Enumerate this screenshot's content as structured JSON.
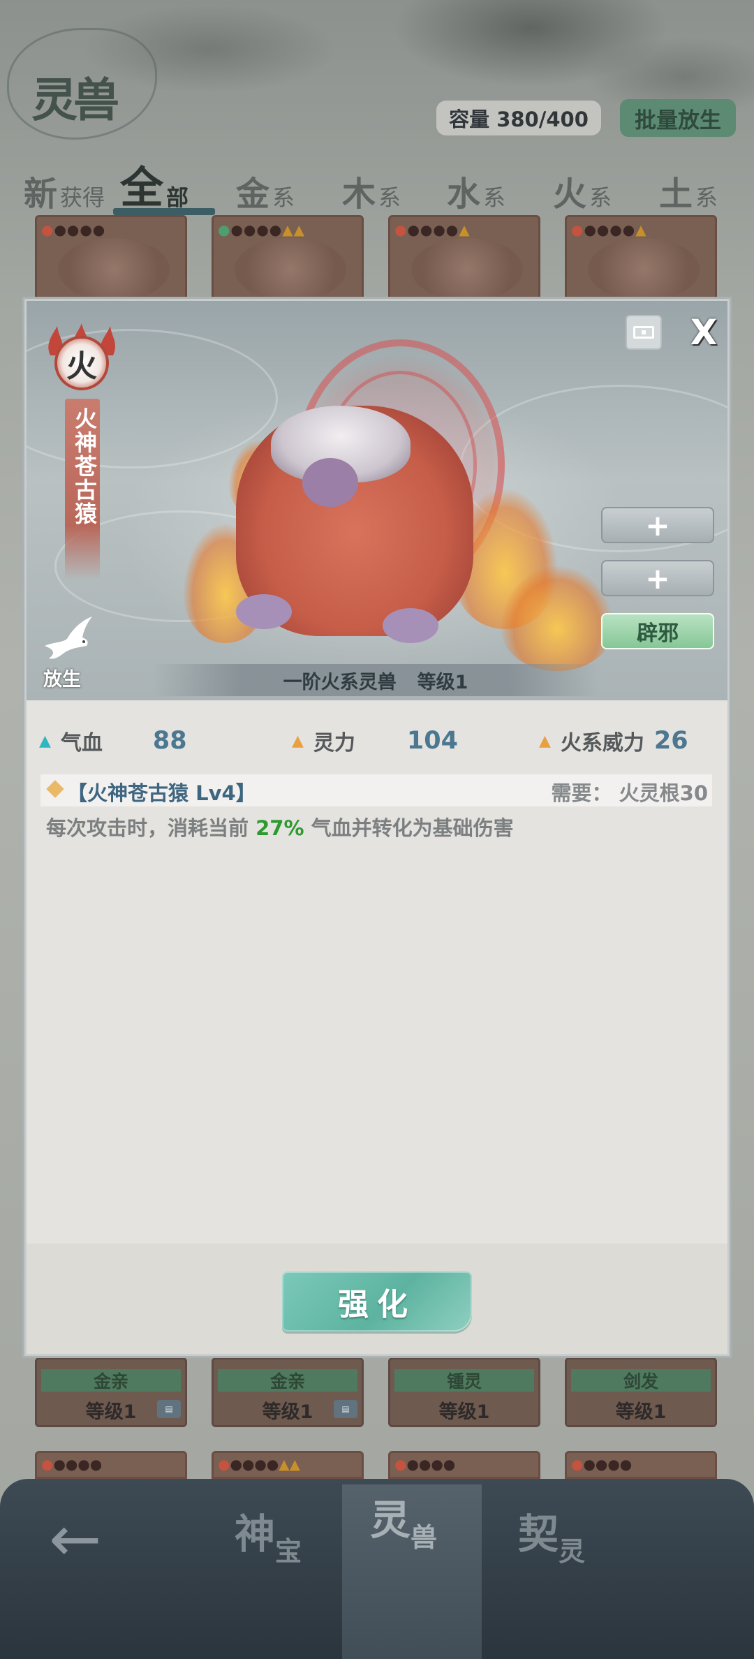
{
  "header": {
    "logo_text": "灵兽",
    "capacity": "容量 380/400",
    "batch_release": "批量放生"
  },
  "tabs": [
    {
      "big": "新",
      "small": "获得"
    },
    {
      "big": "全",
      "small": "部"
    },
    {
      "big": "金",
      "small": "系"
    },
    {
      "big": "木",
      "small": "系"
    },
    {
      "big": "水",
      "small": "系"
    },
    {
      "big": "火",
      "small": "系"
    },
    {
      "big": "土",
      "small": "系"
    }
  ],
  "bottom_cards": [
    {
      "tag": "金亲",
      "level": "等级1"
    },
    {
      "tag": "金亲",
      "level": "等级1"
    },
    {
      "tag": "锺灵",
      "level": "等级1"
    },
    {
      "tag": "剑发",
      "level": "等级1"
    }
  ],
  "bottom_nav": {
    "items": [
      {
        "big": "神",
        "small": "宝"
      },
      {
        "big": "灵",
        "small": "兽"
      },
      {
        "big": "契",
        "small": "灵"
      }
    ]
  },
  "modal": {
    "element": "火",
    "beast_name": "火神苍古猿",
    "release_label": "放生",
    "slot_add_1": "+",
    "slot_add_2": "+",
    "slot_active": "辟邪",
    "caption_rank": "一阶火系灵兽",
    "caption_level": "等级1",
    "stats": [
      {
        "label": "气血",
        "value": "88",
        "color": "#2fb6c0"
      },
      {
        "label": "灵力",
        "value": "104",
        "color": "#e8a040"
      },
      {
        "label": "火系威力",
        "value": "26",
        "color": "#e8a040"
      }
    ],
    "skill": {
      "name": "【火神苍古猿 Lv4】",
      "requirement": "需要：  火灵根30",
      "desc_before": "每次攻击时，消耗当前 ",
      "desc_pct": "27%",
      "desc_after": " 气血并转化为基础伤害"
    },
    "enhance_label": "强化"
  }
}
